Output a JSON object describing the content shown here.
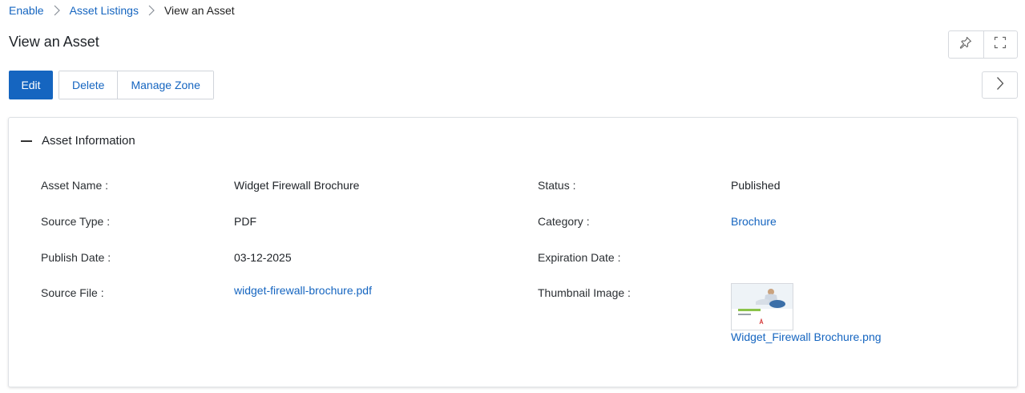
{
  "breadcrumb": {
    "items": [
      {
        "label": "Enable"
      },
      {
        "label": "Asset Listings"
      },
      {
        "label": "View an Asset"
      }
    ]
  },
  "page": {
    "title": "View an Asset"
  },
  "toolbar": {
    "edit_label": "Edit",
    "delete_label": "Delete",
    "manage_zone_label": "Manage Zone"
  },
  "panel": {
    "title": "Asset Information",
    "fields": {
      "asset_name": {
        "label": "Asset Name :",
        "value": "Widget Firewall Brochure"
      },
      "source_type": {
        "label": "Source Type :",
        "value": "PDF"
      },
      "publish_date": {
        "label": "Publish Date :",
        "value": "03-12-2025"
      },
      "source_file": {
        "label": "Source File :",
        "value": "widget-firewall-brochure.pdf"
      },
      "status": {
        "label": "Status :",
        "value": "Published"
      },
      "category": {
        "label": "Category :",
        "value": "Brochure"
      },
      "expiration_date": {
        "label": "Expiration Date :",
        "value": ""
      },
      "thumbnail_image": {
        "label": "Thumbnail Image :",
        "value": "Widget_Firewall Brochure.png"
      }
    },
    "thumbnail_text": {
      "title": "Widget Firewall",
      "subtitle": "Brochure"
    }
  },
  "icons": {
    "pin": "pin-icon",
    "fullscreen": "fullscreen-icon",
    "next": "chevron-right-icon",
    "collapse": "minus-icon",
    "breadcrumb_separator": "chevron-right-icon"
  },
  "colors": {
    "accent": "#1565c0",
    "text": "#1f2328",
    "border": "#d6d9de",
    "thumbnail_accent": "#8bc34a",
    "pdf_red": "#d32f2f"
  }
}
